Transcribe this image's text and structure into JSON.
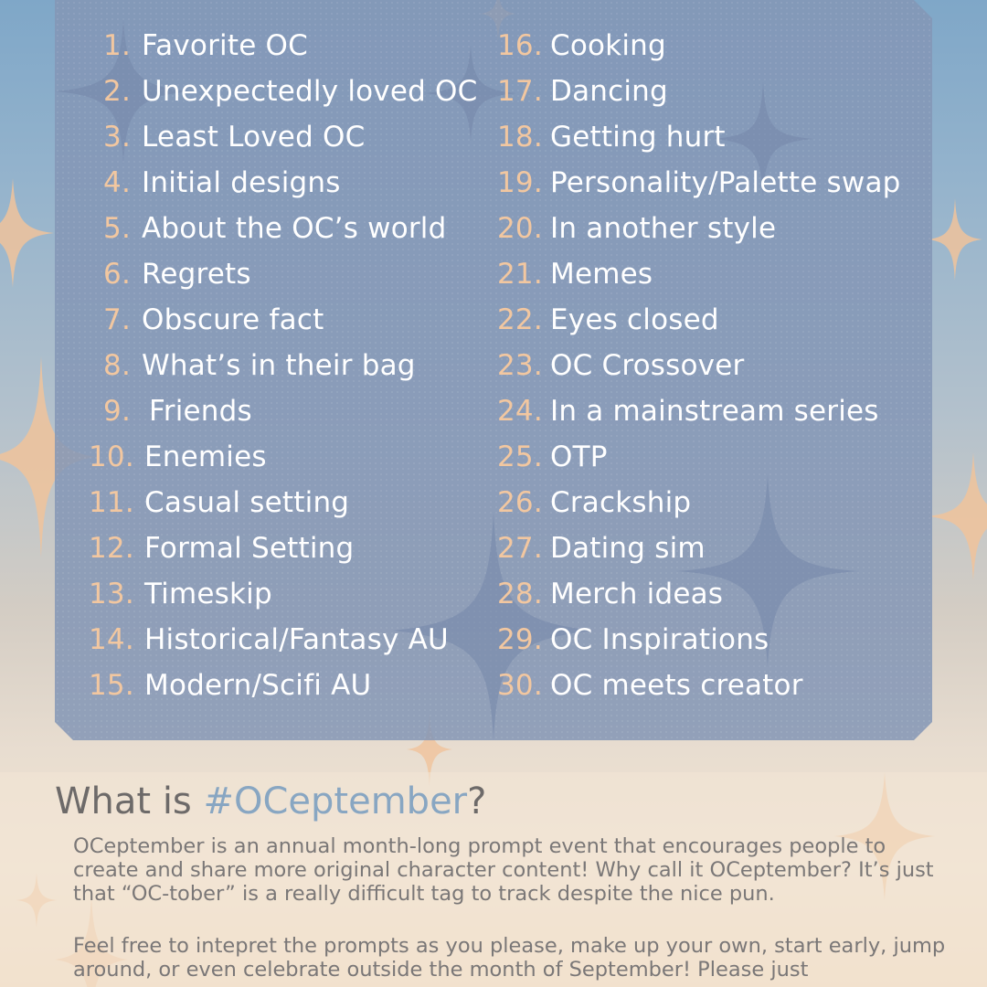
{
  "prompts_left": [
    {
      "num": "1.",
      "text": "Favorite OC"
    },
    {
      "num": "2.",
      "text": "Unexpectedly loved OC"
    },
    {
      "num": "3.",
      "text": "Least Loved OC"
    },
    {
      "num": "4.",
      "text": "Initial designs"
    },
    {
      "num": "5.",
      "text": "About the OC’s world"
    },
    {
      "num": "6.",
      "text": "Regrets"
    },
    {
      "num": "7.",
      "text": "Obscure fact"
    },
    {
      "num": "8.",
      "text": "What’s in their bag"
    },
    {
      "num": "9.",
      "text": "Friends"
    },
    {
      "num": "10.",
      "text": "Enemies"
    },
    {
      "num": "11.",
      "text": "Casual setting"
    },
    {
      "num": "12.",
      "text": "Formal Setting"
    },
    {
      "num": "13.",
      "text": "Timeskip"
    },
    {
      "num": "14.",
      "text": "Historical/Fantasy AU"
    },
    {
      "num": "15.",
      "text": "Modern/Scifi AU"
    }
  ],
  "prompts_right": [
    {
      "num": "16.",
      "text": "Cooking"
    },
    {
      "num": "17.",
      "text": "Dancing"
    },
    {
      "num": "18.",
      "text": "Getting hurt"
    },
    {
      "num": "19.",
      "text": "Personality/Palette swap"
    },
    {
      "num": "20.",
      "text": "In another style"
    },
    {
      "num": "21.",
      "text": "Memes"
    },
    {
      "num": "22.",
      "text": "Eyes closed"
    },
    {
      "num": "23.",
      "text": "OC Crossover"
    },
    {
      "num": "24.",
      "text": "In a mainstream series"
    },
    {
      "num": "25.",
      "text": "OTP"
    },
    {
      "num": "26.",
      "text": "Crackship"
    },
    {
      "num": "27.",
      "text": "Dating sim"
    },
    {
      "num": "28.",
      "text": "Merch ideas"
    },
    {
      "num": "29.",
      "text": "OC Inspirations"
    },
    {
      "num": "30.",
      "text": "OC meets creator"
    }
  ],
  "info": {
    "title_prefix": "What is ",
    "title_hashtag": "#OCeptember",
    "title_suffix": "?",
    "paragraph_1": "OCeptember is an annual month-long prompt event that encourages people to create and share more original character content! Why call it OCeptember? It’s just that “OC-tober” is a really difficult tag to track despite the nice pun.",
    "paragraph_2": "Feel free to intepret the prompts as you please, make up your own, start early, jump around, or even celebrate outside the month of September! Please just"
  },
  "colors": {
    "panel": "#8496b6",
    "number_accent": "#f2c7a0",
    "prompt_text": "#ffffff",
    "hashtag": "#88a6c2",
    "body_text": "#7a7777",
    "sparkle": "#f0c39b"
  },
  "icons": {
    "decoration": "sparkle-star-icon"
  }
}
